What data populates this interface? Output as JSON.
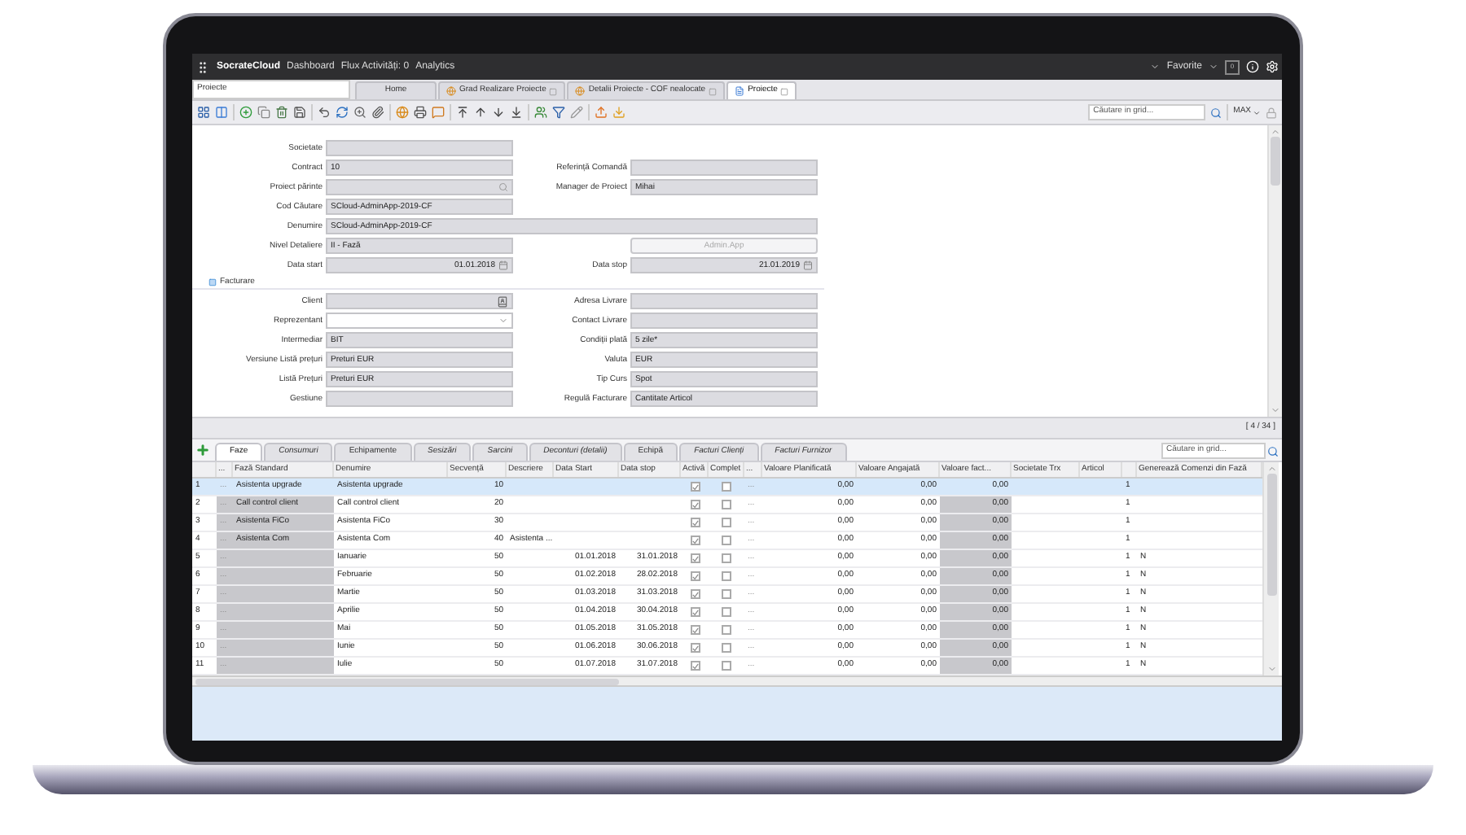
{
  "app_bar": {
    "brand": "SocrateCloud",
    "menu": [
      "Dashboard",
      "Flux Activități: 0",
      "Analytics"
    ],
    "favorites": "Favorite",
    "badge": "0"
  },
  "location_field": {
    "value": "Proiecte"
  },
  "doc_tabs": [
    {
      "label": "Home",
      "selected": false,
      "kind": "plain"
    },
    {
      "label": "Grad Realizare Proiecte",
      "selected": false,
      "kind": "report"
    },
    {
      "label": "Detalii Proiecte - COF nealocate",
      "selected": false,
      "kind": "report"
    },
    {
      "label": "Proiecte",
      "selected": true,
      "kind": "form"
    }
  ],
  "toolbar": {
    "search": {
      "placeholder": "Căutare in grid..."
    },
    "zoom": "MAX"
  },
  "form": {
    "rows": [
      {
        "kind": "pair",
        "left": {
          "label": "Societate",
          "kind": "text"
        }
      },
      {
        "kind": "pair",
        "left": {
          "label": "Contract",
          "value": "10",
          "kind": "text"
        },
        "right": {
          "label": "Referință Comandă",
          "kind": "text"
        }
      },
      {
        "kind": "pair",
        "left": {
          "label": "Proiect părinte",
          "kind": "lookup"
        },
        "right": {
          "label": "Manager de Proiect",
          "value": "Mihai",
          "kind": "text"
        }
      },
      {
        "kind": "pair",
        "left": {
          "label": "Cod Căutare",
          "value": "SCloud-AdminApp-2019-CF",
          "kind": "text"
        }
      },
      {
        "kind": "wide",
        "field": {
          "label": "Denumire",
          "value": "SCloud-AdminApp-2019-CF",
          "kind": "text"
        }
      },
      {
        "kind": "pair",
        "left": {
          "label": "Nivel Detaliere",
          "value": "II - Fază",
          "kind": "text"
        },
        "right": {
          "kind": "button",
          "label": "Admin.App",
          "disabled": true
        }
      },
      {
        "kind": "pair",
        "left": {
          "label": "Data start",
          "value": "01.01.2018",
          "kind": "date"
        },
        "right": {
          "label": "Data stop",
          "value": "21.01.2019",
          "kind": "date"
        }
      },
      {
        "kind": "section",
        "label": "Facturare"
      },
      {
        "kind": "pair",
        "left": {
          "label": "Client",
          "kind": "picker"
        },
        "right": {
          "label": "Adresa Livrare",
          "kind": "text"
        }
      },
      {
        "kind": "pair",
        "left": {
          "label": "Reprezentant",
          "kind": "select"
        },
        "right": {
          "label": "Contact Livrare",
          "kind": "text"
        }
      },
      {
        "kind": "pair",
        "left": {
          "label": "Intermediar",
          "value": "BIT",
          "kind": "text"
        },
        "right": {
          "label": "Condiții plată",
          "value": "5 zile*",
          "kind": "text"
        }
      },
      {
        "kind": "pair",
        "left": {
          "label": "Versiune Listă prețuri",
          "value": "Preturi EUR",
          "kind": "text"
        },
        "right": {
          "label": "Valuta",
          "value": "EUR",
          "kind": "text"
        }
      },
      {
        "kind": "pair",
        "left": {
          "label": "Listă Prețuri",
          "value": "Preturi EUR",
          "kind": "text"
        },
        "right": {
          "label": "Tip Curs",
          "value": "Spot",
          "kind": "text"
        }
      },
      {
        "kind": "pair",
        "left": {
          "label": "Gestiune",
          "kind": "text"
        },
        "right": {
          "label": "Regulă Facturare",
          "value": "Cantitate Articol",
          "kind": "text"
        }
      }
    ],
    "status": "[ 4 / 34 ]"
  },
  "detail_tabs": [
    {
      "label": "Faze",
      "selected": true,
      "italic": false
    },
    {
      "label": "Consumuri",
      "selected": false,
      "italic": true
    },
    {
      "label": "Echipamente",
      "selected": false,
      "italic": false
    },
    {
      "label": "Sesizări",
      "selected": false,
      "italic": true
    },
    {
      "label": "Sarcini",
      "selected": false,
      "italic": true
    },
    {
      "label": "Deconturi (detalii)",
      "selected": false,
      "italic": true
    },
    {
      "label": "Echipă",
      "selected": false,
      "italic": false
    },
    {
      "label": "Facturi Clienți",
      "selected": false,
      "italic": true
    },
    {
      "label": "Facturi Furnizor",
      "selected": false,
      "italic": true
    }
  ],
  "grid_search": {
    "placeholder": "Căutare in grid..."
  },
  "table": {
    "columns": [
      "...",
      "Fază Standard",
      "Denumire",
      "Secvență",
      "Descriere",
      "Data Start",
      "Data stop",
      "Activă",
      "Complet",
      "...",
      "Valoare Planificată",
      "Valoare Angajată",
      "Valoare fact...",
      "Societate Trx",
      "Articol",
      "Generează Comenzi din Fază"
    ],
    "rows": [
      {
        "number": "1",
        "more": "...",
        "faza_standard": "Asistenta upgrade",
        "denumire": "Asistenta upgrade",
        "secventa": "10",
        "activa": true,
        "complet": false,
        "more_2": "...",
        "valoare_planificata": "0,00",
        "valoare_angajata": "0,00",
        "valoare_facturata": "0,00",
        "column_17": "1",
        "selected": true
      },
      {
        "number": "2",
        "more": "...",
        "faza_standard": "Call control client",
        "denumire": "Call control client",
        "secventa": "20",
        "activa": true,
        "complet": false,
        "more_2": "...",
        "valoare_planificata": "0,00",
        "valoare_angajata": "0,00",
        "valoare_facturata": "0,00",
        "column_17": "1",
        "selected": false
      },
      {
        "number": "3",
        "more": "...",
        "faza_standard": "Asistenta FiCo",
        "denumire": "Asistenta FiCo",
        "secventa": "30",
        "activa": true,
        "complet": false,
        "more_2": "...",
        "valoare_planificata": "0,00",
        "valoare_angajata": "0,00",
        "valoare_facturata": "0,00",
        "column_17": "1",
        "selected": false
      },
      {
        "number": "4",
        "more": "...",
        "faza_standard": "Asistenta Com",
        "denumire": "Asistenta Com",
        "secventa": "40",
        "descriere": "Asistenta ...",
        "activa": true,
        "complet": false,
        "more_2": "...",
        "valoare_planificata": "0,00",
        "valoare_angajata": "0,00",
        "valoare_facturata": "0,00",
        "column_17": "1",
        "selected": false
      },
      {
        "number": "5",
        "more": "...",
        "denumire": "Ianuarie",
        "secventa": "50",
        "data_start": "01.01.2018",
        "data_stop": "31.01.2018",
        "activa": true,
        "complet": false,
        "more_2": "...",
        "valoare_planificata": "0,00",
        "valoare_angajata": "0,00",
        "valoare_facturata": "0,00",
        "column_17": "1",
        "genereaza": "N",
        "selected": false
      },
      {
        "number": "6",
        "more": "...",
        "denumire": "Februarie",
        "secventa": "50",
        "data_start": "01.02.2018",
        "data_stop": "28.02.2018",
        "activa": true,
        "complet": false,
        "more_2": "...",
        "valoare_planificata": "0,00",
        "valoare_angajata": "0,00",
        "valoare_facturata": "0,00",
        "column_17": "1",
        "genereaza": "N",
        "selected": false
      },
      {
        "number": "7",
        "more": "...",
        "denumire": "Martie",
        "secventa": "50",
        "data_start": "01.03.2018",
        "data_stop": "31.03.2018",
        "activa": true,
        "complet": false,
        "more_2": "...",
        "valoare_planificata": "0,00",
        "valoare_angajata": "0,00",
        "valoare_facturata": "0,00",
        "column_17": "1",
        "genereaza": "N",
        "selected": false
      },
      {
        "number": "8",
        "more": "...",
        "denumire": "Aprilie",
        "secventa": "50",
        "data_start": "01.04.2018",
        "data_stop": "30.04.2018",
        "activa": true,
        "complet": false,
        "more_2": "...",
        "valoare_planificata": "0,00",
        "valoare_angajata": "0,00",
        "valoare_facturata": "0,00",
        "column_17": "1",
        "genereaza": "N",
        "selected": false
      },
      {
        "number": "9",
        "more": "...",
        "denumire": "Mai",
        "secventa": "50",
        "data_start": "01.05.2018",
        "data_stop": "31.05.2018",
        "activa": true,
        "complet": false,
        "more_2": "...",
        "valoare_planificata": "0,00",
        "valoare_angajata": "0,00",
        "valoare_facturata": "0,00",
        "column_17": "1",
        "genereaza": "N",
        "selected": false
      },
      {
        "number": "10",
        "more": "...",
        "denumire": "Iunie",
        "secventa": "50",
        "data_start": "01.06.2018",
        "data_stop": "30.06.2018",
        "activa": true,
        "complet": false,
        "more_2": "...",
        "valoare_planificata": "0,00",
        "valoare_angajata": "0,00",
        "valoare_facturata": "0,00",
        "column_17": "1",
        "genereaza": "N",
        "selected": false
      },
      {
        "number": "11",
        "more": "...",
        "denumire": "Iulie",
        "secventa": "50",
        "data_start": "01.07.2018",
        "data_stop": "31.07.2018",
        "activa": true,
        "complet": false,
        "more_2": "...",
        "valoare_planificata": "0,00",
        "valoare_angajata": "0,00",
        "valoare_facturata": "0,00",
        "column_17": "1",
        "genereaza": "N",
        "selected": false
      }
    ]
  }
}
